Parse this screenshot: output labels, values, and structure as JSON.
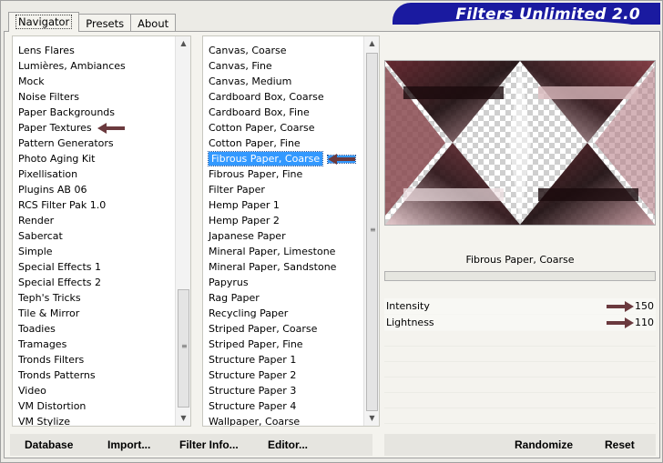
{
  "banner": {
    "title": "Filters Unlimited 2.0"
  },
  "tabs": [
    {
      "label": "Navigator",
      "active": true
    },
    {
      "label": "Presets",
      "active": false
    },
    {
      "label": "About",
      "active": false
    }
  ],
  "categories": {
    "items": [
      "Lens Flares",
      "Lumières, Ambiances",
      "Mock",
      "Noise Filters",
      "Paper Backgrounds",
      "Paper Textures",
      "Pattern Generators",
      "Photo Aging Kit",
      "Pixellisation",
      "Plugins AB 06",
      "RCS Filter Pak 1.0",
      "Render",
      "Sabercat",
      "Simple",
      "Special Effects 1",
      "Special Effects 2",
      "Teph's Tricks",
      "Tile & Mirror",
      "Toadies",
      "Tramages",
      "Tronds Filters",
      "Tronds Patterns",
      "Video",
      "VM Distortion",
      "VM Stylize"
    ],
    "highlighted": "Paper Textures"
  },
  "filters": {
    "items": [
      "Canvas, Coarse",
      "Canvas, Fine",
      "Canvas, Medium",
      "Cardboard Box, Coarse",
      "Cardboard Box, Fine",
      "Cotton Paper, Coarse",
      "Cotton Paper, Fine",
      "Fibrous Paper, Coarse",
      "Fibrous Paper, Fine",
      "Filter Paper",
      "Hemp Paper 1",
      "Hemp Paper 2",
      "Japanese Paper",
      "Mineral Paper, Limestone",
      "Mineral Paper, Sandstone",
      "Papyrus",
      "Rag Paper",
      "Recycling Paper",
      "Striped Paper, Coarse",
      "Striped Paper, Fine",
      "Structure Paper 1",
      "Structure Paper 2",
      "Structure Paper 3",
      "Structure Paper 4",
      "Wallpaper, Coarse"
    ],
    "selected": "Fibrous Paper, Coarse"
  },
  "preview": {
    "filter_name": "Fibrous Paper, Coarse"
  },
  "params": [
    {
      "label": "Intensity",
      "value": "150"
    },
    {
      "label": "Lightness",
      "value": "110"
    }
  ],
  "buttons": {
    "database": "Database",
    "import": "Import...",
    "filter_info": "Filter Info...",
    "editor": "Editor...",
    "randomize": "Randomize",
    "reset": "Reset"
  },
  "colors": {
    "selection": "#3399ff",
    "banner": "#1a1aa0",
    "arrow": "#6b3a3e"
  }
}
